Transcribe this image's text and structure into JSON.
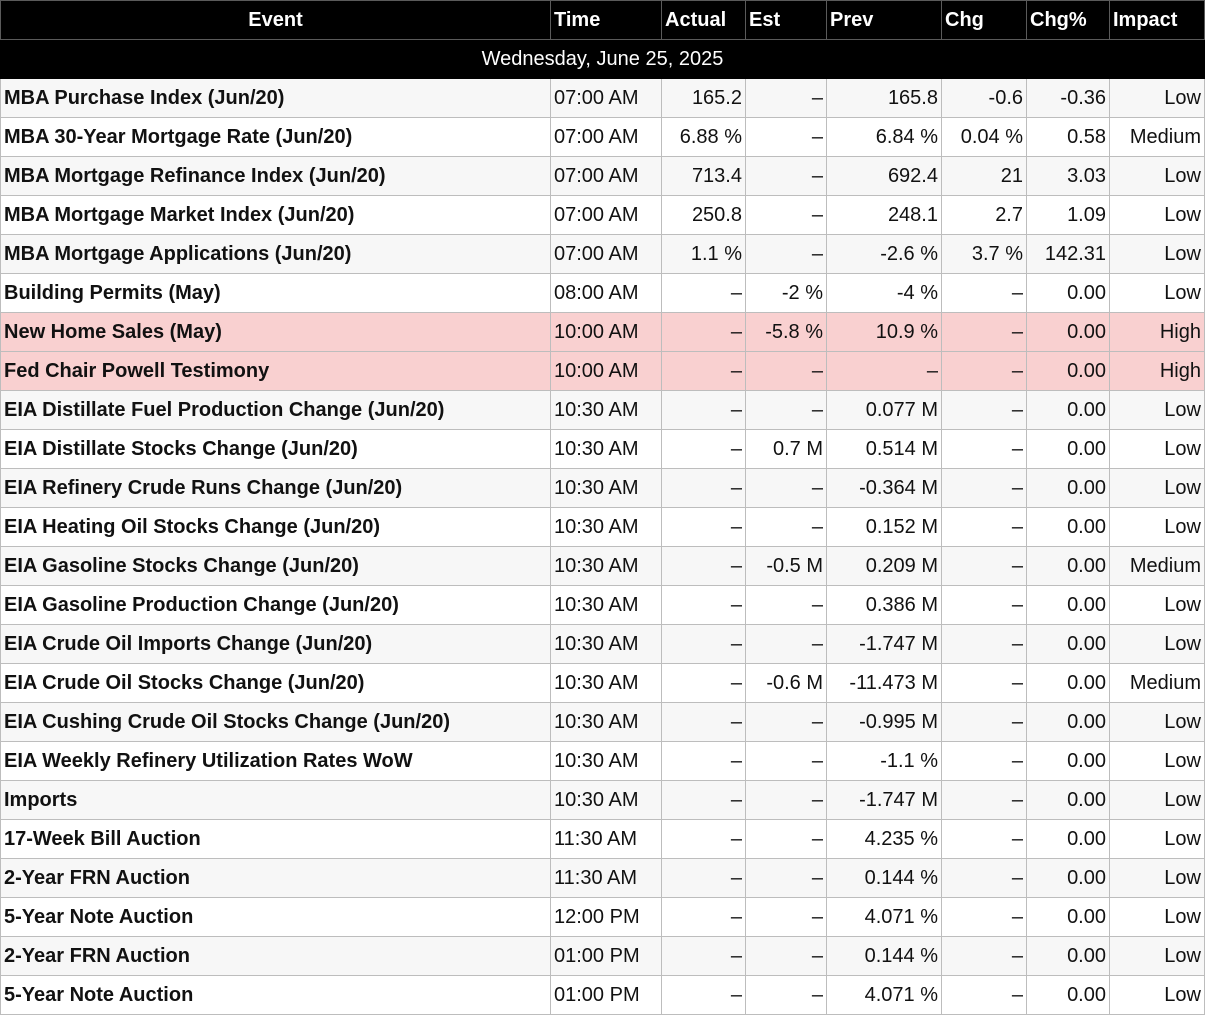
{
  "colors": {
    "header_bg": "#000000",
    "header_text": "#ffffff",
    "high_bg": "#f9d0d0",
    "row_alt": "#f7f7f7"
  },
  "columns": [
    "Event",
    "Time",
    "Actual",
    "Est",
    "Prev",
    "Chg",
    "Chg%",
    "Impact"
  ],
  "date_label": "Wednesday, June 25, 2025",
  "rows": [
    {
      "event": "MBA Purchase Index (Jun/20)",
      "time": "07:00 AM",
      "actual": "165.2",
      "est": "–",
      "prev": "165.8",
      "chg": "-0.6",
      "chgp": "-0.36",
      "impact": "Low"
    },
    {
      "event": "MBA 30-Year Mortgage Rate (Jun/20)",
      "time": "07:00 AM",
      "actual": "6.88 %",
      "est": "–",
      "prev": "6.84 %",
      "chg": "0.04 %",
      "chgp": "0.58",
      "impact": "Medium"
    },
    {
      "event": "MBA Mortgage Refinance Index (Jun/20)",
      "time": "07:00 AM",
      "actual": "713.4",
      "est": "–",
      "prev": "692.4",
      "chg": "21",
      "chgp": "3.03",
      "impact": "Low"
    },
    {
      "event": "MBA Mortgage Market Index (Jun/20)",
      "time": "07:00 AM",
      "actual": "250.8",
      "est": "–",
      "prev": "248.1",
      "chg": "2.7",
      "chgp": "1.09",
      "impact": "Low"
    },
    {
      "event": "MBA Mortgage Applications (Jun/20)",
      "time": "07:00 AM",
      "actual": "1.1 %",
      "est": "–",
      "prev": "-2.6 %",
      "chg": "3.7 %",
      "chgp": "142.31",
      "impact": "Low"
    },
    {
      "event": "Building Permits (May)",
      "time": "08:00 AM",
      "actual": "–",
      "est": "-2 %",
      "prev": "-4 %",
      "chg": "–",
      "chgp": "0.00",
      "impact": "Low"
    },
    {
      "event": "New Home Sales (May)",
      "time": "10:00 AM",
      "actual": "–",
      "est": "-5.8 %",
      "prev": "10.9 %",
      "chg": "–",
      "chgp": "0.00",
      "impact": "High"
    },
    {
      "event": "Fed Chair Powell Testimony",
      "time": "10:00 AM",
      "actual": "–",
      "est": "–",
      "prev": "–",
      "chg": "–",
      "chgp": "0.00",
      "impact": "High"
    },
    {
      "event": "EIA Distillate Fuel Production Change (Jun/20)",
      "time": "10:30 AM",
      "actual": "–",
      "est": "–",
      "prev": "0.077 M",
      "chg": "–",
      "chgp": "0.00",
      "impact": "Low"
    },
    {
      "event": "EIA Distillate Stocks Change (Jun/20)",
      "time": "10:30 AM",
      "actual": "–",
      "est": "0.7 M",
      "prev": "0.514 M",
      "chg": "–",
      "chgp": "0.00",
      "impact": "Low"
    },
    {
      "event": "EIA Refinery Crude Runs Change (Jun/20)",
      "time": "10:30 AM",
      "actual": "–",
      "est": "–",
      "prev": "-0.364 M",
      "chg": "–",
      "chgp": "0.00",
      "impact": "Low"
    },
    {
      "event": "EIA Heating Oil Stocks Change (Jun/20)",
      "time": "10:30 AM",
      "actual": "–",
      "est": "–",
      "prev": "0.152 M",
      "chg": "–",
      "chgp": "0.00",
      "impact": "Low"
    },
    {
      "event": "EIA Gasoline Stocks Change (Jun/20)",
      "time": "10:30 AM",
      "actual": "–",
      "est": "-0.5 M",
      "prev": "0.209 M",
      "chg": "–",
      "chgp": "0.00",
      "impact": "Medium"
    },
    {
      "event": "EIA Gasoline Production Change (Jun/20)",
      "time": "10:30 AM",
      "actual": "–",
      "est": "–",
      "prev": "0.386 M",
      "chg": "–",
      "chgp": "0.00",
      "impact": "Low"
    },
    {
      "event": "EIA Crude Oil Imports Change (Jun/20)",
      "time": "10:30 AM",
      "actual": "–",
      "est": "–",
      "prev": "-1.747 M",
      "chg": "–",
      "chgp": "0.00",
      "impact": "Low"
    },
    {
      "event": "EIA Crude Oil Stocks Change (Jun/20)",
      "time": "10:30 AM",
      "actual": "–",
      "est": "-0.6 M",
      "prev": "-11.473 M",
      "chg": "–",
      "chgp": "0.00",
      "impact": "Medium"
    },
    {
      "event": "EIA Cushing Crude Oil Stocks Change (Jun/20)",
      "time": "10:30 AM",
      "actual": "–",
      "est": "–",
      "prev": "-0.995 M",
      "chg": "–",
      "chgp": "0.00",
      "impact": "Low"
    },
    {
      "event": "EIA Weekly Refinery Utilization Rates WoW",
      "time": "10:30 AM",
      "actual": "–",
      "est": "–",
      "prev": "-1.1 %",
      "chg": "–",
      "chgp": "0.00",
      "impact": "Low"
    },
    {
      "event": "Imports",
      "time": "10:30 AM",
      "actual": "–",
      "est": "–",
      "prev": "-1.747 M",
      "chg": "–",
      "chgp": "0.00",
      "impact": "Low"
    },
    {
      "event": "17-Week Bill Auction",
      "time": "11:30 AM",
      "actual": "–",
      "est": "–",
      "prev": "4.235 %",
      "chg": "–",
      "chgp": "0.00",
      "impact": "Low"
    },
    {
      "event": "2-Year FRN Auction",
      "time": "11:30 AM",
      "actual": "–",
      "est": "–",
      "prev": "0.144 %",
      "chg": "–",
      "chgp": "0.00",
      "impact": "Low"
    },
    {
      "event": "5-Year Note Auction",
      "time": "12:00 PM",
      "actual": "–",
      "est": "–",
      "prev": "4.071 %",
      "chg": "–",
      "chgp": "0.00",
      "impact": "Low"
    },
    {
      "event": "2-Year FRN Auction",
      "time": "01:00 PM",
      "actual": "–",
      "est": "–",
      "prev": "0.144 %",
      "chg": "–",
      "chgp": "0.00",
      "impact": "Low"
    },
    {
      "event": "5-Year Note Auction",
      "time": "01:00 PM",
      "actual": "–",
      "est": "–",
      "prev": "4.071 %",
      "chg": "–",
      "chgp": "0.00",
      "impact": "Low"
    }
  ]
}
